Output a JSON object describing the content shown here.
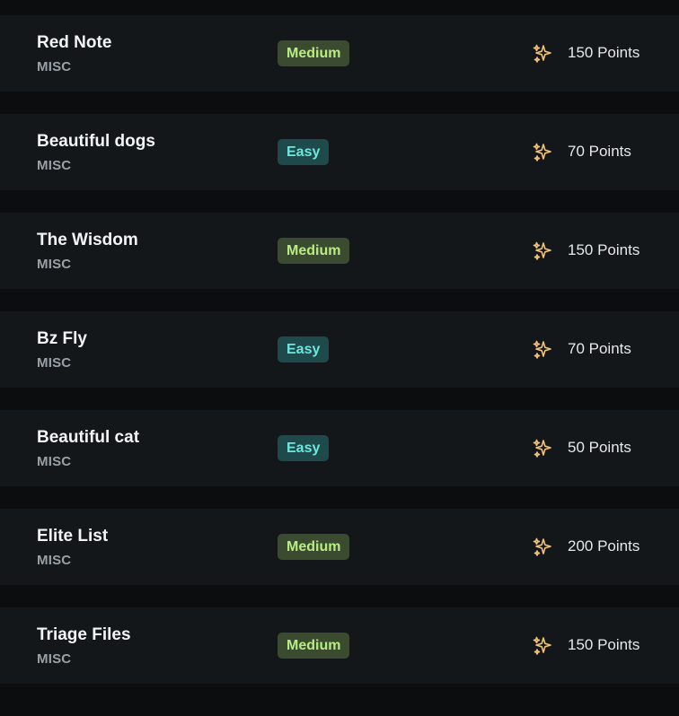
{
  "challenges": [
    {
      "title": "Red Note",
      "category": "MISC",
      "difficulty": "Medium",
      "points": "150 Points"
    },
    {
      "title": "Beautiful dogs",
      "category": "MISC",
      "difficulty": "Easy",
      "points": "70 Points"
    },
    {
      "title": "The Wisdom",
      "category": "MISC",
      "difficulty": "Medium",
      "points": "150 Points"
    },
    {
      "title": "Bz Fly",
      "category": "MISC",
      "difficulty": "Easy",
      "points": "70 Points"
    },
    {
      "title": "Beautiful cat",
      "category": "MISC",
      "difficulty": "Easy",
      "points": "50 Points"
    },
    {
      "title": "Elite List",
      "category": "MISC",
      "difficulty": "Medium",
      "points": "200 Points"
    },
    {
      "title": "Triage Files",
      "category": "MISC",
      "difficulty": "Medium",
      "points": "150 Points"
    }
  ],
  "icons": {
    "points": "sparkles-icon"
  },
  "colors": {
    "page_bg": "#0b0d0f",
    "row_bg": "#13171a",
    "medium_bg": "#3b4b30",
    "medium_text": "#b9ec84",
    "easy_bg": "#1f4a4b",
    "easy_text": "#6fe6de",
    "sparkle": "#f2c27a"
  }
}
